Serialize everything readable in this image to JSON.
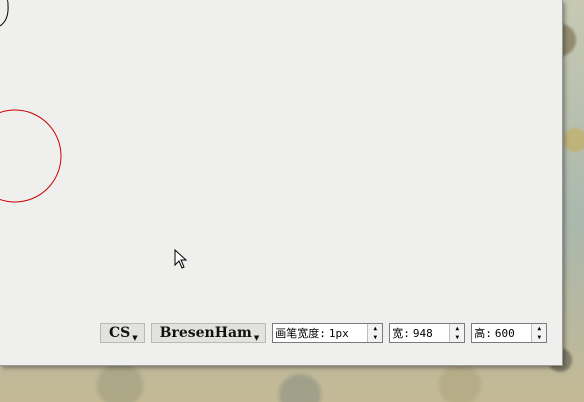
{
  "canvas": {
    "shapes": [
      "partial-black-circle",
      "red-circle"
    ]
  },
  "toolbar": {
    "mode_label": "CS",
    "algorithm_label": "BresenHam",
    "pen_width": {
      "label": "画笔宽度:",
      "value": "1px"
    },
    "width": {
      "label": "宽:",
      "value": "948"
    },
    "height": {
      "label": "高:",
      "value": "600"
    }
  },
  "icons": {
    "dropdown": "triangle-down-icon",
    "spin_up": "spin-up-icon",
    "spin_down": "spin-down-icon",
    "pointer": "mouse-pointer-icon"
  },
  "colors": {
    "circle_stroke": "#000000",
    "red_circle_stroke": "#cc0000",
    "window_bg": "#efefed"
  }
}
